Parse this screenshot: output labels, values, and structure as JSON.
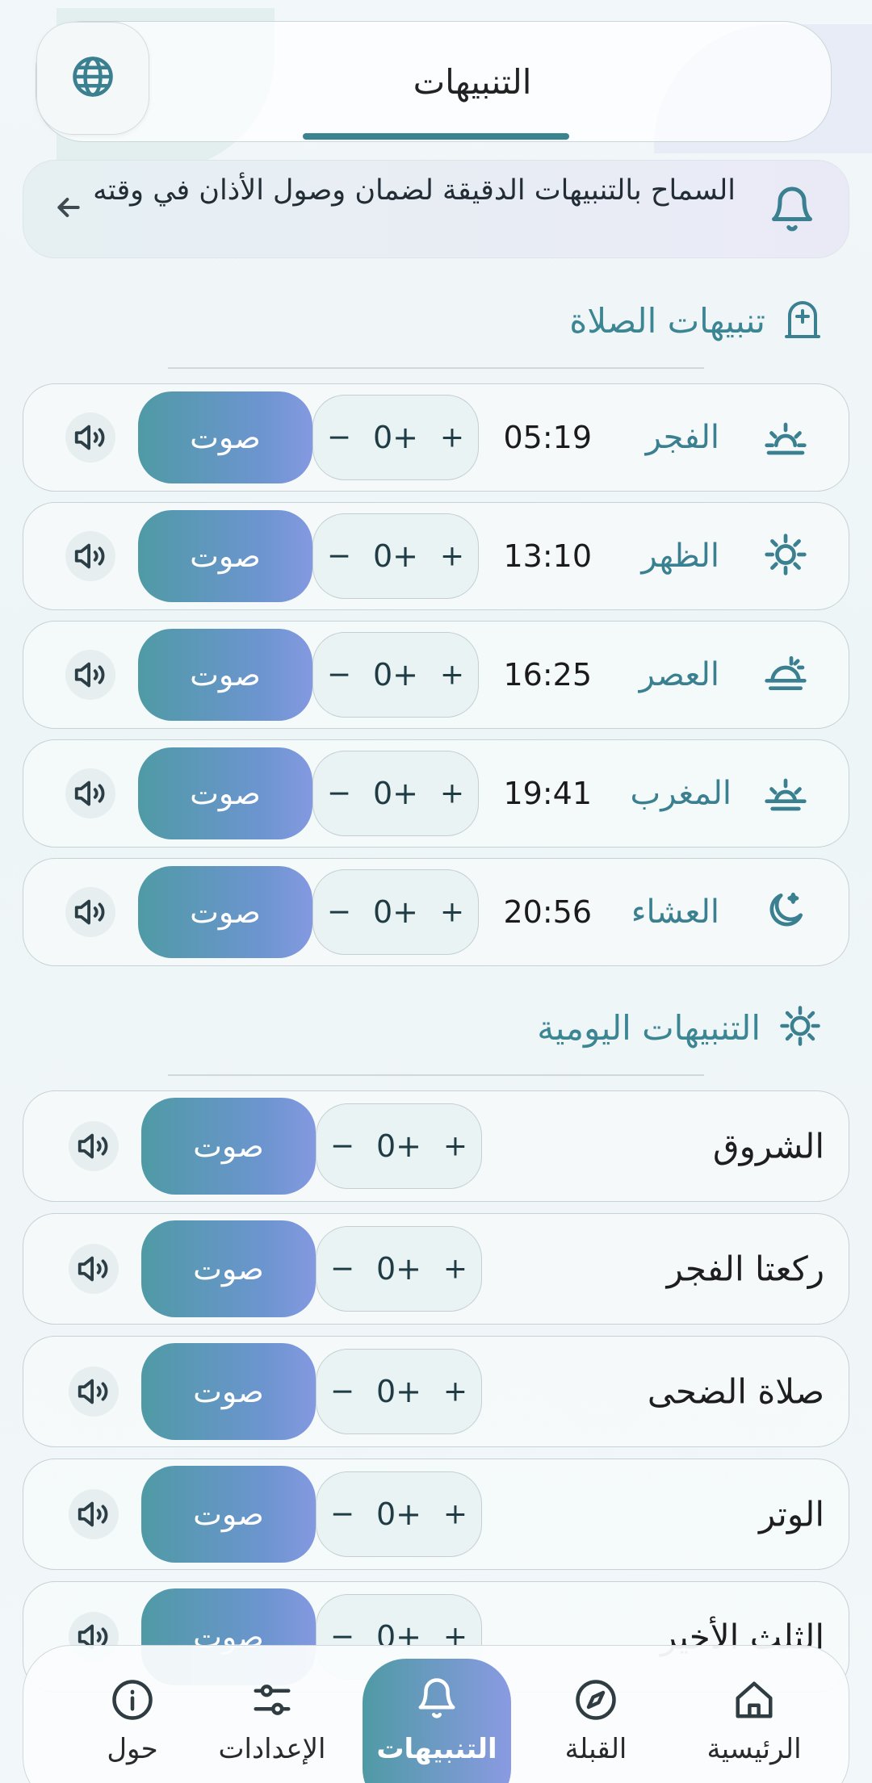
{
  "header": {
    "title": "التنبيهات",
    "globe_icon": "globe-icon"
  },
  "banner": {
    "text": "السماح بالتنبيهات الدقيقة لضمان وصول الأذان في وقته"
  },
  "prayer_section": {
    "title": "تنبيهات الصلاة"
  },
  "prayers": [
    {
      "name": "الفجر",
      "time": "05:19",
      "offset": "0+",
      "sound": "صوت",
      "icon": "sunrise-icon"
    },
    {
      "name": "الظهر",
      "time": "13:10",
      "offset": "0+",
      "sound": "صوت",
      "icon": "sun-icon"
    },
    {
      "name": "العصر",
      "time": "16:25",
      "offset": "0+",
      "sound": "صوت",
      "icon": "sun-cloud-icon"
    },
    {
      "name": "المغرب",
      "time": "19:41",
      "offset": "0+",
      "sound": "صوت",
      "icon": "sunset-icon"
    },
    {
      "name": "العشاء",
      "time": "20:56",
      "offset": "0+",
      "sound": "صوت",
      "icon": "moon-icon"
    }
  ],
  "daily_section": {
    "title": "التنبيهات اليومية"
  },
  "daily": [
    {
      "name": "الشروق",
      "offset": "0+",
      "sound": "صوت"
    },
    {
      "name": "ركعتا الفجر",
      "offset": "0+",
      "sound": "صوت"
    },
    {
      "name": "صلاة الضحى",
      "offset": "0+",
      "sound": "صوت"
    },
    {
      "name": "الوتر",
      "offset": "0+",
      "sound": "صوت"
    },
    {
      "name": "الثلث الأخير",
      "offset": "0+",
      "sound": "صوت"
    }
  ],
  "stepper": {
    "plus": "+",
    "minus": "−"
  },
  "nav": {
    "home": "الرئيسية",
    "qibla": "القبلة",
    "alerts": "التنبيهات",
    "settings": "الإعدادات",
    "about": "حول"
  },
  "colors": {
    "accent": "#3b8090",
    "gradient_start": "#4f9aa5",
    "gradient_end": "#8499e0"
  }
}
